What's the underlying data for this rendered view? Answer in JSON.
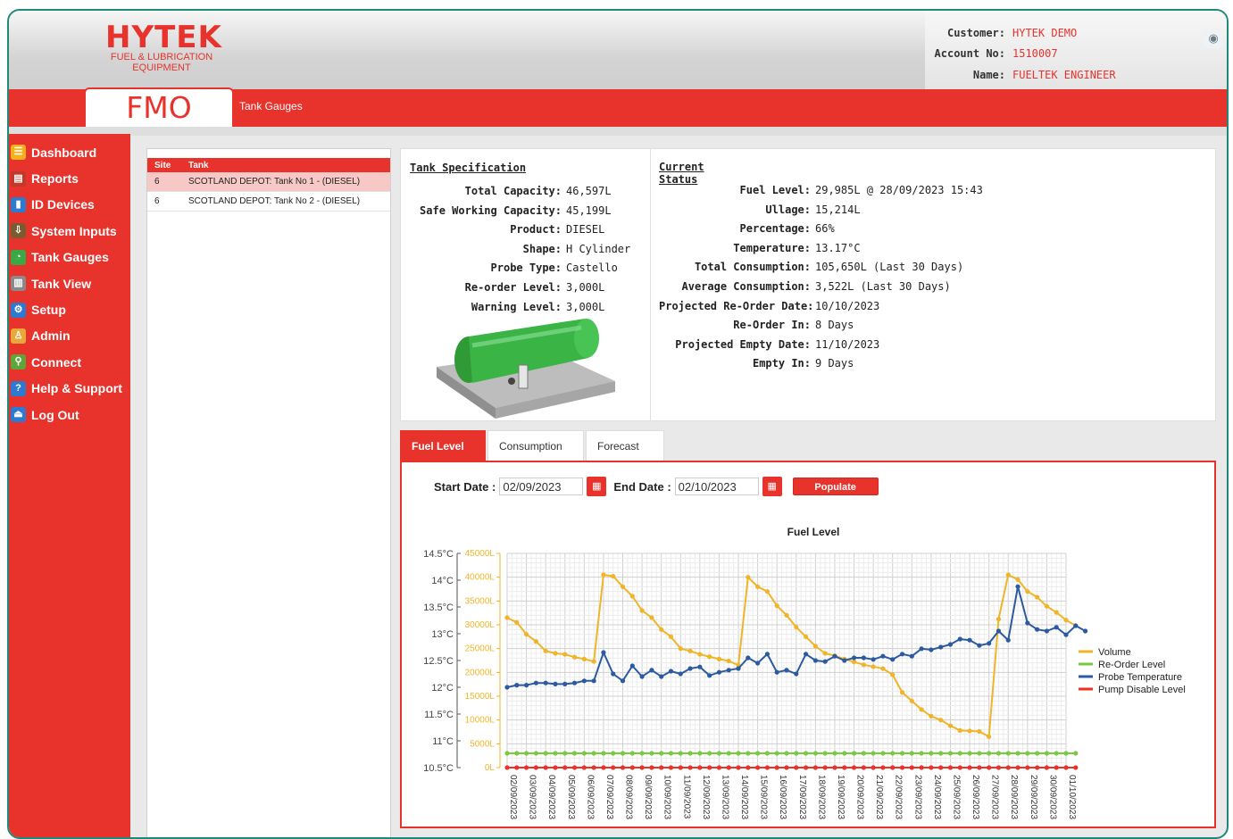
{
  "header": {
    "logo_main": "HYTEK",
    "logo_sub1": "FUEL & LUBRICATION",
    "logo_sub2": "EQUIPMENT",
    "app_name": "FMO",
    "breadcrumb": "Tank Gauges",
    "customer_label": "Customer:",
    "customer_value": "HYTEK DEMO",
    "account_label": "Account No:",
    "account_value": "1510007",
    "name_label": "Name:",
    "name_value": "FUELTEK ENGINEER"
  },
  "sidebar": {
    "items": [
      {
        "label": "Dashboard",
        "icon": "dashboard-icon",
        "color": "#f3b21b",
        "glyph": "☰"
      },
      {
        "label": "Reports",
        "icon": "reports-icon",
        "color": "#c0392b",
        "glyph": "▤"
      },
      {
        "label": "ID Devices",
        "icon": "id-devices-icon",
        "color": "#2e7ad1",
        "glyph": "▮"
      },
      {
        "label": "System Inputs",
        "icon": "system-inputs-icon",
        "color": "#7a5c2e",
        "glyph": "⇩"
      },
      {
        "label": "Tank Gauges",
        "icon": "tank-gauges-icon",
        "color": "#3aa845",
        "glyph": "◔"
      },
      {
        "label": "Tank View",
        "icon": "tank-view-icon",
        "color": "#8a8a8a",
        "glyph": "▥"
      },
      {
        "label": "Setup",
        "icon": "setup-icon",
        "color": "#2e7ad1",
        "glyph": "⚙"
      },
      {
        "label": "Admin",
        "icon": "admin-icon",
        "color": "#e9a93a",
        "glyph": "♙"
      },
      {
        "label": "Connect",
        "icon": "connect-icon",
        "color": "#5ea53a",
        "glyph": "⚲"
      },
      {
        "label": "Help & Support",
        "icon": "help-icon",
        "color": "#2e7ad1",
        "glyph": "?"
      },
      {
        "label": "Log Out",
        "icon": "logout-icon",
        "color": "#2e7ad1",
        "glyph": "⏏"
      }
    ]
  },
  "tanklist": {
    "col_site": "Site",
    "col_tank": "Tank",
    "rows": [
      {
        "site": "6",
        "tank": "SCOTLAND DEPOT: Tank No 1 - (DIESEL)"
      },
      {
        "site": "6",
        "tank": "SCOTLAND DEPOT: Tank No 2 - (DIESEL)"
      }
    ]
  },
  "spec": {
    "title": "Tank Specification",
    "rows": [
      {
        "k": "Total Capacity:",
        "v": "46,597L"
      },
      {
        "k": "Safe Working Capacity:",
        "v": "45,199L"
      },
      {
        "k": "Product:",
        "v": "DIESEL"
      },
      {
        "k": "Shape:",
        "v": "H Cylinder"
      },
      {
        "k": "Probe Type:",
        "v": "Castello"
      },
      {
        "k": "Re-order Level:",
        "v": "3,000L"
      },
      {
        "k": "Warning Level:",
        "v": "3,000L"
      }
    ]
  },
  "status": {
    "title": "Current Status",
    "rows": [
      {
        "k": "Fuel Level:",
        "v": "29,985L @ 28/09/2023 15:43"
      },
      {
        "k": "Ullage:",
        "v": "15,214L"
      },
      {
        "k": "Percentage:",
        "v": "66%"
      },
      {
        "k": "Temperature:",
        "v": "13.17°C"
      },
      {
        "k": "Total Consumption:",
        "v": "105,650L (Last 30 Days)"
      },
      {
        "k": "Average Consumption:",
        "v": "3,522L (Last 30 Days)"
      },
      {
        "k": "Projected Re-Order Date:",
        "v": "10/10/2023"
      },
      {
        "k": "Re-Order In:",
        "v": "8 Days"
      },
      {
        "k": "Projected Empty Date:",
        "v": "11/10/2023"
      },
      {
        "k": "Empty In:",
        "v": "9 Days"
      }
    ]
  },
  "tabs": [
    {
      "label": "Fuel Level",
      "active": true
    },
    {
      "label": "Consumption",
      "active": false
    },
    {
      "label": "Forecast",
      "active": false
    }
  ],
  "datebar": {
    "start_label": "Start Date :",
    "start_value": "02/09/2023",
    "end_label": "End Date :",
    "end_value": "02/10/2023",
    "populate_label": "Populate"
  },
  "chart_data": {
    "type": "line",
    "title": "Fuel Level",
    "x": [
      "02/09/2023",
      "03/09/2023",
      "04/09/2023",
      "05/09/2023",
      "06/09/2023",
      "07/09/2023",
      "08/09/2023",
      "09/09/2023",
      "10/09/2023",
      "11/09/2023",
      "12/09/2023",
      "13/09/2023",
      "14/09/2023",
      "15/09/2023",
      "16/09/2023",
      "17/09/2023",
      "18/09/2023",
      "19/09/2023",
      "20/09/2023",
      "21/09/2023",
      "22/09/2023",
      "23/09/2023",
      "24/09/2023",
      "25/09/2023",
      "26/09/2023",
      "27/09/2023",
      "28/09/2023",
      "29/09/2023",
      "30/09/2023",
      "01/10/2023"
    ],
    "y_left_ticks": [
      "14.5°C",
      "14°C",
      "13.5°C",
      "13°C",
      "12.5°C",
      "12°C",
      "11.5°C",
      "11°C",
      "10.5°C"
    ],
    "y_left_range": [
      10.5,
      14.5
    ],
    "y_right_ticks": [
      "45000L",
      "40000L",
      "35000L",
      "30000L",
      "25000L",
      "20000L",
      "15000L",
      "10000L",
      "5000L",
      "0L"
    ],
    "y_right_range": [
      0,
      45000
    ],
    "colors": {
      "volume": "#f0b429",
      "reorder": "#7ac943",
      "temperature": "#2c5aa0",
      "pump": "#e8322c"
    },
    "series": [
      {
        "name": "Volume",
        "axis": "right",
        "x_step": 0.5,
        "values": [
          31500,
          30500,
          28000,
          26500,
          24500,
          24000,
          23800,
          23200,
          22800,
          22300,
          40500,
          40200,
          38000,
          36000,
          33000,
          31500,
          29000,
          27500,
          25000,
          24500,
          23800,
          23300,
          22800,
          22400,
          21500,
          40000,
          38000,
          37000,
          34000,
          32000,
          29500,
          27500,
          25500,
          24000,
          23500,
          22800,
          22200,
          21600,
          21200,
          20800,
          19500,
          15800,
          14000,
          12200,
          10800,
          10000,
          8800,
          7800,
          7700,
          7600,
          6500,
          31200,
          40500,
          39500,
          37000,
          35800,
          33900,
          32600,
          31000,
          29800
        ]
      },
      {
        "name": "Re-Order Level",
        "axis": "right",
        "x_step": 0.5,
        "values": [
          3000,
          3000,
          3000,
          3000,
          3000,
          3000,
          3000,
          3000,
          3000,
          3000,
          3000,
          3000,
          3000,
          3000,
          3000,
          3000,
          3000,
          3000,
          3000,
          3000,
          3000,
          3000,
          3000,
          3000,
          3000,
          3000,
          3000,
          3000,
          3000,
          3000,
          3000,
          3000,
          3000,
          3000,
          3000,
          3000,
          3000,
          3000,
          3000,
          3000,
          3000,
          3000,
          3000,
          3000,
          3000,
          3000,
          3000,
          3000,
          3000,
          3000,
          3000,
          3000,
          3000,
          3000,
          3000,
          3000,
          3000,
          3000,
          3000,
          3000
        ]
      },
      {
        "name": "Probe Temperature",
        "axis": "left",
        "x_step": 0.5,
        "values": [
          12.0,
          12.04,
          12.04,
          12.08,
          12.08,
          12.06,
          12.06,
          12.08,
          12.12,
          12.12,
          12.65,
          12.25,
          12.12,
          12.4,
          12.2,
          12.32,
          12.2,
          12.3,
          12.25,
          12.35,
          12.38,
          12.22,
          12.28,
          12.32,
          12.35,
          12.55,
          12.45,
          12.62,
          12.28,
          12.32,
          12.25,
          12.62,
          12.5,
          12.48,
          12.58,
          12.5,
          12.55,
          12.55,
          12.52,
          12.58,
          12.52,
          12.62,
          12.58,
          12.72,
          12.7,
          12.75,
          12.8,
          12.9,
          12.88,
          12.78,
          12.82,
          13.05,
          12.88,
          13.88,
          13.2,
          13.08,
          13.05,
          13.12,
          12.98,
          13.15,
          13.05
        ]
      },
      {
        "name": "Pump Disable Level",
        "axis": "right",
        "x_step": 0.5,
        "values": [
          0,
          0,
          0,
          0,
          0,
          0,
          0,
          0,
          0,
          0,
          0,
          0,
          0,
          0,
          0,
          0,
          0,
          0,
          0,
          0,
          0,
          0,
          0,
          0,
          0,
          0,
          0,
          0,
          0,
          0,
          0,
          0,
          0,
          0,
          0,
          0,
          0,
          0,
          0,
          0,
          0,
          0,
          0,
          0,
          0,
          0,
          0,
          0,
          0,
          0,
          0,
          0,
          0,
          0,
          0,
          0,
          0,
          0,
          0,
          0
        ]
      }
    ],
    "legend": [
      "Volume",
      "Re-Order Level",
      "Probe Temperature",
      "Pump Disable Level"
    ],
    "legend_position": "right",
    "grid": true
  }
}
